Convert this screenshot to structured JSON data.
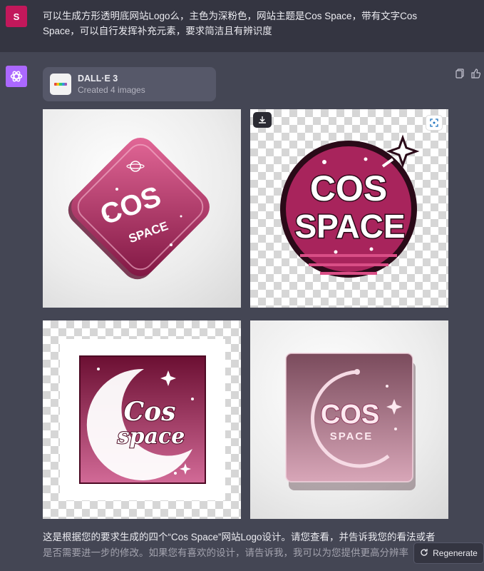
{
  "user": {
    "avatar_letter": "S",
    "message": "可以生成方形透明底网站Logo么，主色为深粉色，网站主题是Cos Space，带有文字Cos Space，可以自行发挥补充元素，要求简洁且有辨识度"
  },
  "assistant": {
    "tool": {
      "name": "DALL·E 3",
      "status": "Created 4 images"
    },
    "images": [
      {
        "logo_line1": "COS",
        "logo_line2": "SPACE"
      },
      {
        "logo_line1": "COS",
        "logo_line2": "SPACE"
      },
      {
        "logo_line1": "Cos",
        "logo_line2": "space"
      },
      {
        "logo_line1": "COS",
        "logo_line2": "SPACE"
      }
    ],
    "answer_visible": "这是根据您的要求生成的四个“Cos Space”网站Logo设计。请您查看，并告诉我您的看法或者",
    "answer_fade": "是否需要进一步的修改。如果您有喜欢的设计，请告诉我，我可以为您提供更高分辨率"
  },
  "controls": {
    "regenerate_label": "Regenerate"
  },
  "colors": {
    "accent_pink": "#c2185b",
    "deep_pink": "#8e1a47",
    "gpt_purple": "#ab68ff"
  }
}
